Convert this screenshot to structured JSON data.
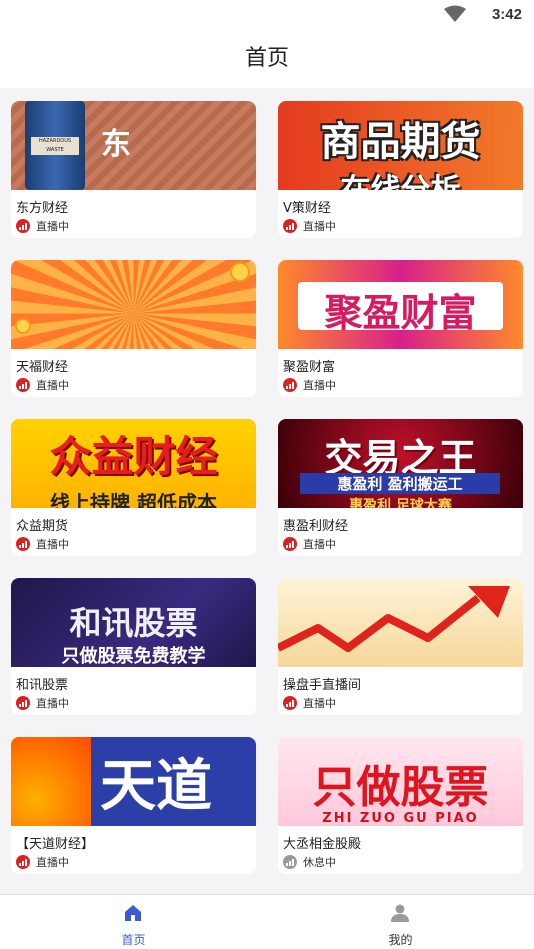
{
  "status_bar": {
    "time": "3:42"
  },
  "header": {
    "title": "首页"
  },
  "cards": [
    {
      "name": "东方财经",
      "status": "直播中",
      "live": true,
      "banner": "东"
    },
    {
      "name": "V策财经",
      "status": "直播中",
      "live": true,
      "banner": "商品期货",
      "banner2": "在线分析"
    },
    {
      "name": "天福财经",
      "status": "直播中",
      "live": true,
      "banner": ""
    },
    {
      "name": "聚盈财富",
      "status": "直播中",
      "live": true,
      "banner": "聚盈财富"
    },
    {
      "name": "众益期货",
      "status": "直播中",
      "live": true,
      "banner": "众益财经",
      "banner2": "线上持牌 超低成本"
    },
    {
      "name": "惠盈利财经",
      "status": "直播中",
      "live": true,
      "banner": "交易之王",
      "banner2": "惠盈利 盈利搬运工",
      "banner3": "惠盈利 足球大赛"
    },
    {
      "name": "和讯股票",
      "status": "直播中",
      "live": true,
      "banner": "和讯股票",
      "banner2": "只做股票免费教学"
    },
    {
      "name": "操盘手直播间",
      "status": "直播中",
      "live": true,
      "banner": ""
    },
    {
      "name": "【天道财经】",
      "status": "直播中",
      "live": true,
      "banner": "天道"
    },
    {
      "name": "大丞相金股殿",
      "status": "休息中",
      "live": false,
      "banner": "只做股票",
      "banner2": "ZHI ZUO GU PIAO"
    }
  ],
  "tabbar": {
    "home_label": "首页",
    "mine_label": "我的",
    "active_color": "#3b5bdb"
  }
}
